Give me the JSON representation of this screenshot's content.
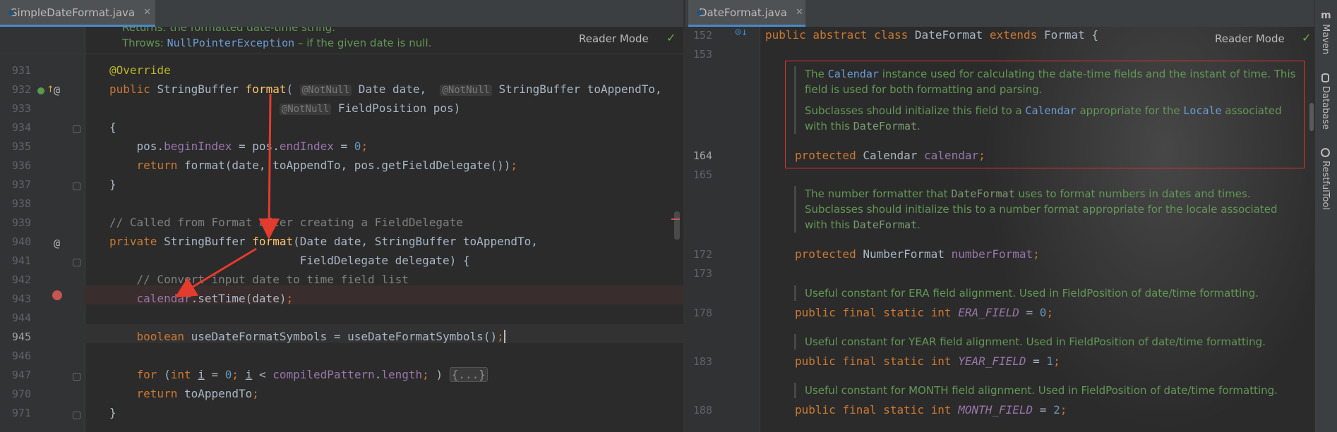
{
  "left_tab": {
    "title": "SimpleDateFormat.java",
    "close": "✕"
  },
  "right_tab": {
    "title": "DateFormat.java",
    "close": "✕"
  },
  "reader_mode": "Reader Mode",
  "left": {
    "doc_returns": "Returns: the formatted date-time string.",
    "doc_throws_label": "Throws: ",
    "doc_throws_link": "NullPointerException",
    "doc_throws_rest": " – if the given date is null.",
    "line_numbers": [
      "931",
      "932",
      "933",
      "934",
      "935",
      "936",
      "937",
      "938",
      "939",
      "940",
      "941",
      "942",
      "943",
      "944",
      "945",
      "946",
      "947",
      "970",
      "971"
    ]
  },
  "right": {
    "line_numbers": [
      "152",
      "153",
      "164",
      "165",
      "172",
      "173",
      "178",
      "183",
      "188"
    ],
    "doc1": {
      "p1_a": "The ",
      "p1_code": "Calendar",
      "p1_b": " instance used for calculating the date-time fields and the instant of time. This field is used for both formatting and parsing.",
      "p2_a": "Subclasses should initialize this field to a ",
      "p2_code1": "Calendar",
      "p2_b": " appropriate for the ",
      "p2_code2": "Locale",
      "p2_c": " associated with this ",
      "p2_code3": "DateFormat",
      "p2_d": "."
    },
    "doc2": {
      "a": "The number formatter that ",
      "code1": "DateFormat",
      "b": " uses to format numbers in dates and times. Subclasses should initialize this to a number format appropriate for the locale associated with this ",
      "code2": "DateFormat",
      "c": "."
    },
    "doc3": "Useful constant for ERA field alignment. Used in FieldPosition of date/time formatting.",
    "doc4": "Useful constant for YEAR field alignment. Used in FieldPosition of date/time formatting.",
    "doc5": "Useful constant for MONTH field alignment. Used in FieldPosition of date/time formatting."
  },
  "sidebar": {
    "items": [
      "Maven",
      "Database",
      "RestfulTool"
    ]
  },
  "colors": {
    "accent": "#4a88c7",
    "highlight_box": "#e0312f",
    "arrow": "#e33b2e",
    "breakpoint": "#c75450"
  }
}
